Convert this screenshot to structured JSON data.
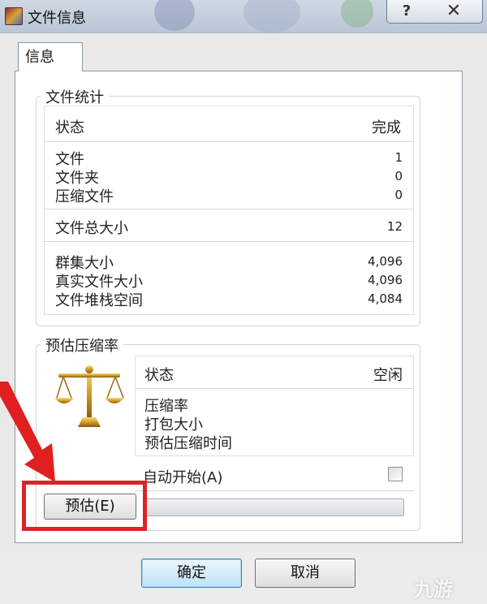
{
  "window": {
    "title": "文件信息",
    "help_label": "?",
    "close_label": "✕"
  },
  "tab": {
    "label": "信息"
  },
  "file_stats": {
    "title": "文件统计",
    "status_label": "状态",
    "status_value": "完成",
    "rows_a": [
      {
        "label": "文件",
        "value": "1"
      },
      {
        "label": "文件夹",
        "value": "0"
      },
      {
        "label": "压缩文件",
        "value": "0"
      }
    ],
    "total_size": {
      "label": "文件总大小",
      "value": "12"
    },
    "rows_c": [
      {
        "label": "群集大小",
        "value": "4,096"
      },
      {
        "label": "真实文件大小",
        "value": "4,096"
      },
      {
        "label": "文件堆栈空间",
        "value": "4,084"
      }
    ]
  },
  "estimate": {
    "title": "预估压缩率",
    "status_label": "状态",
    "status_value": "空闲",
    "fields": [
      "压缩率",
      "打包大小",
      "预估压缩时间"
    ],
    "auto_start_label": "自动开始(A)",
    "auto_start_checked": false,
    "estimate_button": "预估(E)",
    "progress": 0
  },
  "footer": {
    "ok_label": "确定",
    "cancel_label": "取消"
  },
  "watermark": "九游",
  "colors": {
    "highlight": "#d9252a",
    "arrow": "#e02020",
    "default_button": "#3c7fb1"
  }
}
